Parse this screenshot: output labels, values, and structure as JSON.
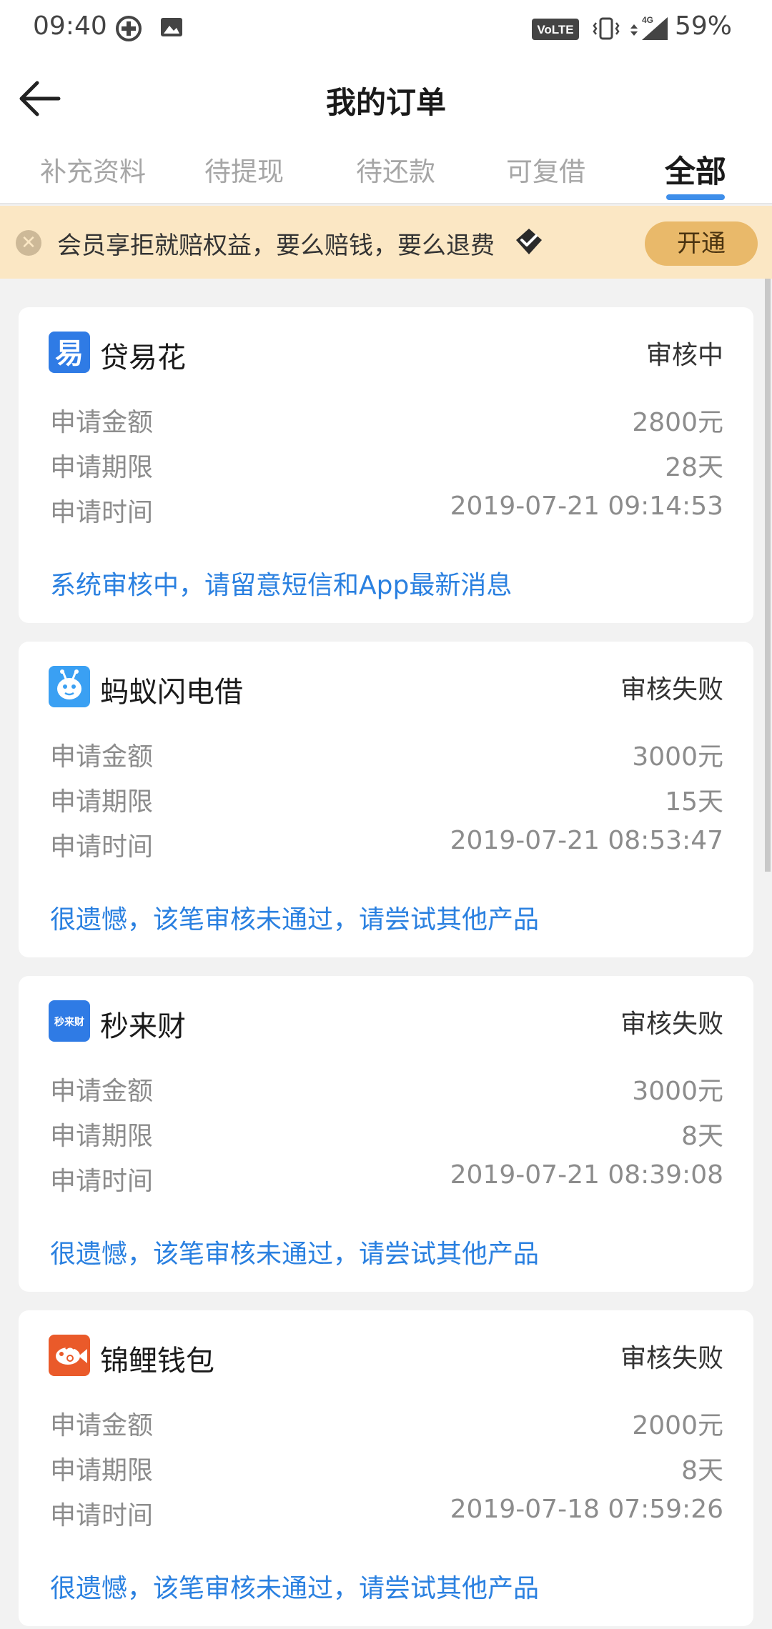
{
  "status_bar": {
    "time": "09:40",
    "battery": "59%",
    "icons": [
      "plus-circle-icon",
      "image-icon",
      "volte-icon",
      "vibrate-icon",
      "signal-4g-icon"
    ],
    "volte_label": "VoLTE",
    "network_label": "4G"
  },
  "header": {
    "title": "我的订单",
    "back_icon": "back-arrow-icon"
  },
  "tabs": [
    {
      "label": "补充资料",
      "active": false
    },
    {
      "label": "待提现",
      "active": false
    },
    {
      "label": "待还款",
      "active": false
    },
    {
      "label": "可复借",
      "active": false
    },
    {
      "label": "全部",
      "active": true
    }
  ],
  "banner": {
    "text": "会员享拒就赔权益，要么赔钱，要么退费",
    "button": "开通",
    "close_icon": "close-icon",
    "badge_icon": "diamond-icon"
  },
  "labels": {
    "amount": "申请金额",
    "term": "申请期限",
    "time": "申请时间"
  },
  "orders": [
    {
      "name": "贷易花",
      "status": "审核中",
      "amount": "2800元",
      "term": "28天",
      "time": "2019-07-21 09:14:53",
      "message": "系统审核中，请留意短信和App最新消息",
      "logo_text": "易",
      "logo_color": "#2f7be5"
    },
    {
      "name": "蚂蚁闪电借",
      "status": "审核失败",
      "amount": "3000元",
      "term": "15天",
      "time": "2019-07-21 08:53:47",
      "message": "很遗憾，该笔审核未通过，请尝试其他产品",
      "logo_text": "",
      "logo_color": "#3aa0f3"
    },
    {
      "name": "秒来财",
      "status": "审核失败",
      "amount": "3000元",
      "term": "8天",
      "time": "2019-07-21 08:39:08",
      "message": "很遗憾，该笔审核未通过，请尝试其他产品",
      "logo_text": "秒来财",
      "logo_color": "#2f7be5"
    },
    {
      "name": "锦鲤钱包",
      "status": "审核失败",
      "amount": "2000元",
      "term": "8天",
      "time": "2019-07-18 07:59:26",
      "message": "很遗憾，该笔审核未通过，请尝试其他产品",
      "logo_text": "",
      "logo_color": "#ea5a2a"
    }
  ],
  "colors": {
    "accent": "#3e8eea",
    "link": "#2a80e0",
    "banner_bg": "#fbe7c4",
    "banner_button": "#e9b96a"
  }
}
